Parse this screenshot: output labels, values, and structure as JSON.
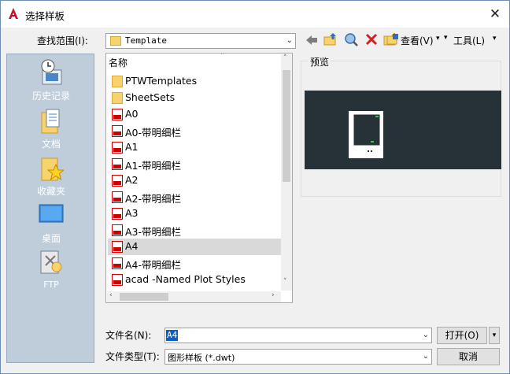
{
  "window": {
    "title": "选择样板",
    "close_glyph": "✕"
  },
  "lookin": {
    "label": "查找范围(I):",
    "value": "Template"
  },
  "toolbar": {
    "view_label": "查看(V)",
    "tools_label": "工具(L)"
  },
  "places": [
    {
      "label": "历史记录",
      "icon": "history-icon"
    },
    {
      "label": "文档",
      "icon": "documents-icon"
    },
    {
      "label": "收藏夹",
      "icon": "favorites-icon"
    },
    {
      "label": "桌面",
      "icon": "desktop-icon"
    },
    {
      "label": "FTP",
      "icon": "ftp-icon"
    }
  ],
  "filelist": {
    "column_header": "名称",
    "items": [
      {
        "name": "PTWTemplates",
        "type": "folder"
      },
      {
        "name": "SheetSets",
        "type": "folder"
      },
      {
        "name": "A0",
        "type": "dwt"
      },
      {
        "name": "A0-带明细栏",
        "type": "dwt"
      },
      {
        "name": "A1",
        "type": "dwt"
      },
      {
        "name": "A1-带明细栏",
        "type": "dwt"
      },
      {
        "name": "A2",
        "type": "dwt"
      },
      {
        "name": "A2-带明细栏",
        "type": "dwt"
      },
      {
        "name": "A3",
        "type": "dwt"
      },
      {
        "name": "A3-带明细栏",
        "type": "dwt"
      },
      {
        "name": "A4",
        "type": "dwt",
        "selected": true
      },
      {
        "name": "A4-带明细栏",
        "type": "dwt"
      },
      {
        "name": "acad -Named Plot Styles",
        "type": "dwt"
      }
    ]
  },
  "preview": {
    "label": "预览"
  },
  "filename": {
    "label": "文件名(N):",
    "value": "A4"
  },
  "filetype": {
    "label": "文件类型(T):",
    "value": "图形样板 (*.dwt)"
  },
  "buttons": {
    "open": "打开(O)",
    "cancel": "取消"
  },
  "colors": {
    "places_bg": "#bfcddb",
    "preview_bg": "#263238",
    "selection": "#d9d9d9",
    "accent_red": "#c00000"
  }
}
